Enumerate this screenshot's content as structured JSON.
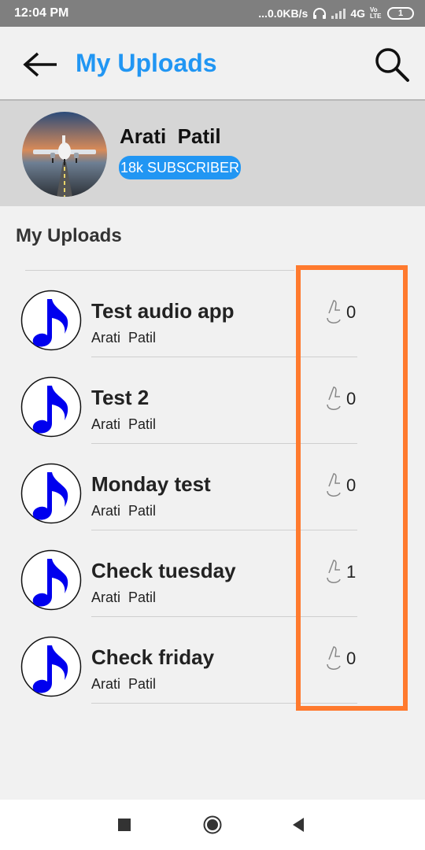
{
  "status_bar": {
    "time": "12:04 PM",
    "network_speed": "...0.0KB/s",
    "network_type": "4G",
    "volte": "Vo LTE",
    "battery": "1"
  },
  "header": {
    "title": "My Uploads",
    "back_icon": "arrow-left-icon",
    "search_icon": "search-icon"
  },
  "profile": {
    "name": "Arati  Patil",
    "subscribers": "18k SUBSCRIBER"
  },
  "section_title": "My Uploads",
  "uploads": [
    {
      "title": "Test audio app",
      "author": "Arati  Patil",
      "likes": "0"
    },
    {
      "title": "Test 2",
      "author": "Arati  Patil",
      "likes": "0"
    },
    {
      "title": "Monday test",
      "author": "Arati  Patil",
      "likes": "0"
    },
    {
      "title": "Check tuesday",
      "author": "Arati  Patil",
      "likes": "1"
    },
    {
      "title": "Check friday",
      "author": "Arati  Patil",
      "likes": "0"
    }
  ],
  "colors": {
    "accent": "#2196f3",
    "highlight": "#ff7a2e",
    "note": "#0000ee"
  }
}
